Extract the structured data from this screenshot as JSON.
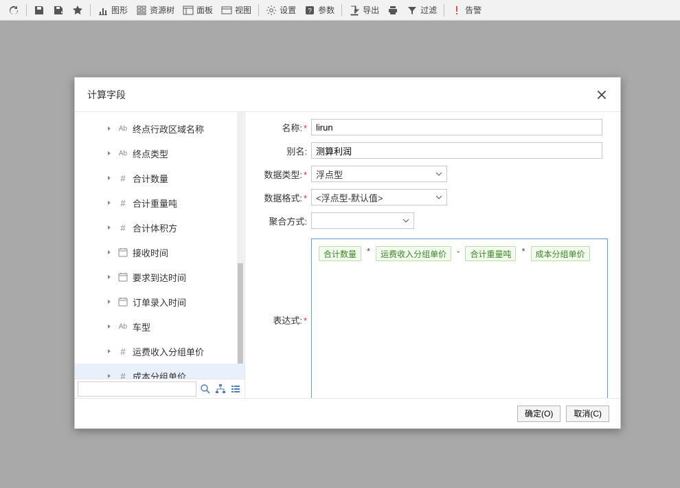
{
  "toolbar": {
    "refresh": "",
    "save": "",
    "saveas": "",
    "star": "",
    "chart": "图形",
    "tree": "资源树",
    "panel": "面板",
    "view": "视图",
    "settings": "设置",
    "params": "参数",
    "export": "导出",
    "print": "",
    "filter": "过滤",
    "alert": "告警"
  },
  "dialog": {
    "title": "计算字段",
    "tree": {
      "items": [
        {
          "icon": "text",
          "label": "终点行政区域名称"
        },
        {
          "icon": "text",
          "label": "终点类型"
        },
        {
          "icon": "number",
          "label": "合计数量"
        },
        {
          "icon": "number",
          "label": "合计重量吨"
        },
        {
          "icon": "number",
          "label": "合计体积方"
        },
        {
          "icon": "date",
          "label": "接收时间"
        },
        {
          "icon": "date",
          "label": "要求到达时间"
        },
        {
          "icon": "date",
          "label": "订单录入时间"
        },
        {
          "icon": "text",
          "label": "车型"
        },
        {
          "icon": "number",
          "label": "运费收入分组单价"
        },
        {
          "icon": "number",
          "label": "成本分组单价",
          "selected": true
        }
      ],
      "search_placeholder": ""
    },
    "form": {
      "name_label": "名称:",
      "name_value": "lirun",
      "alias_label": "别名:",
      "alias_value": "测算利润",
      "dtype_label": "数据类型:",
      "dtype_value": "浮点型",
      "dformat_label": "数据格式:",
      "dformat_value": "<浮点型-默认值>",
      "agg_label": "聚合方式:",
      "agg_value": "",
      "expr_label": "表达式:",
      "expr_tokens": [
        {
          "t": "field",
          "v": "合计数量"
        },
        {
          "t": "op",
          "v": "*"
        },
        {
          "t": "field",
          "v": "运费收入分组单价"
        },
        {
          "t": "op",
          "v": "-"
        },
        {
          "t": "field",
          "v": "合计重量吨"
        },
        {
          "t": "op",
          "v": "*"
        },
        {
          "t": "field",
          "v": "成本分组单价"
        }
      ]
    },
    "buttons": {
      "ok": "确定(O)",
      "cancel": "取消(C)"
    }
  },
  "icons": {
    "text": "Ab",
    "number": "#",
    "date": "cal"
  }
}
